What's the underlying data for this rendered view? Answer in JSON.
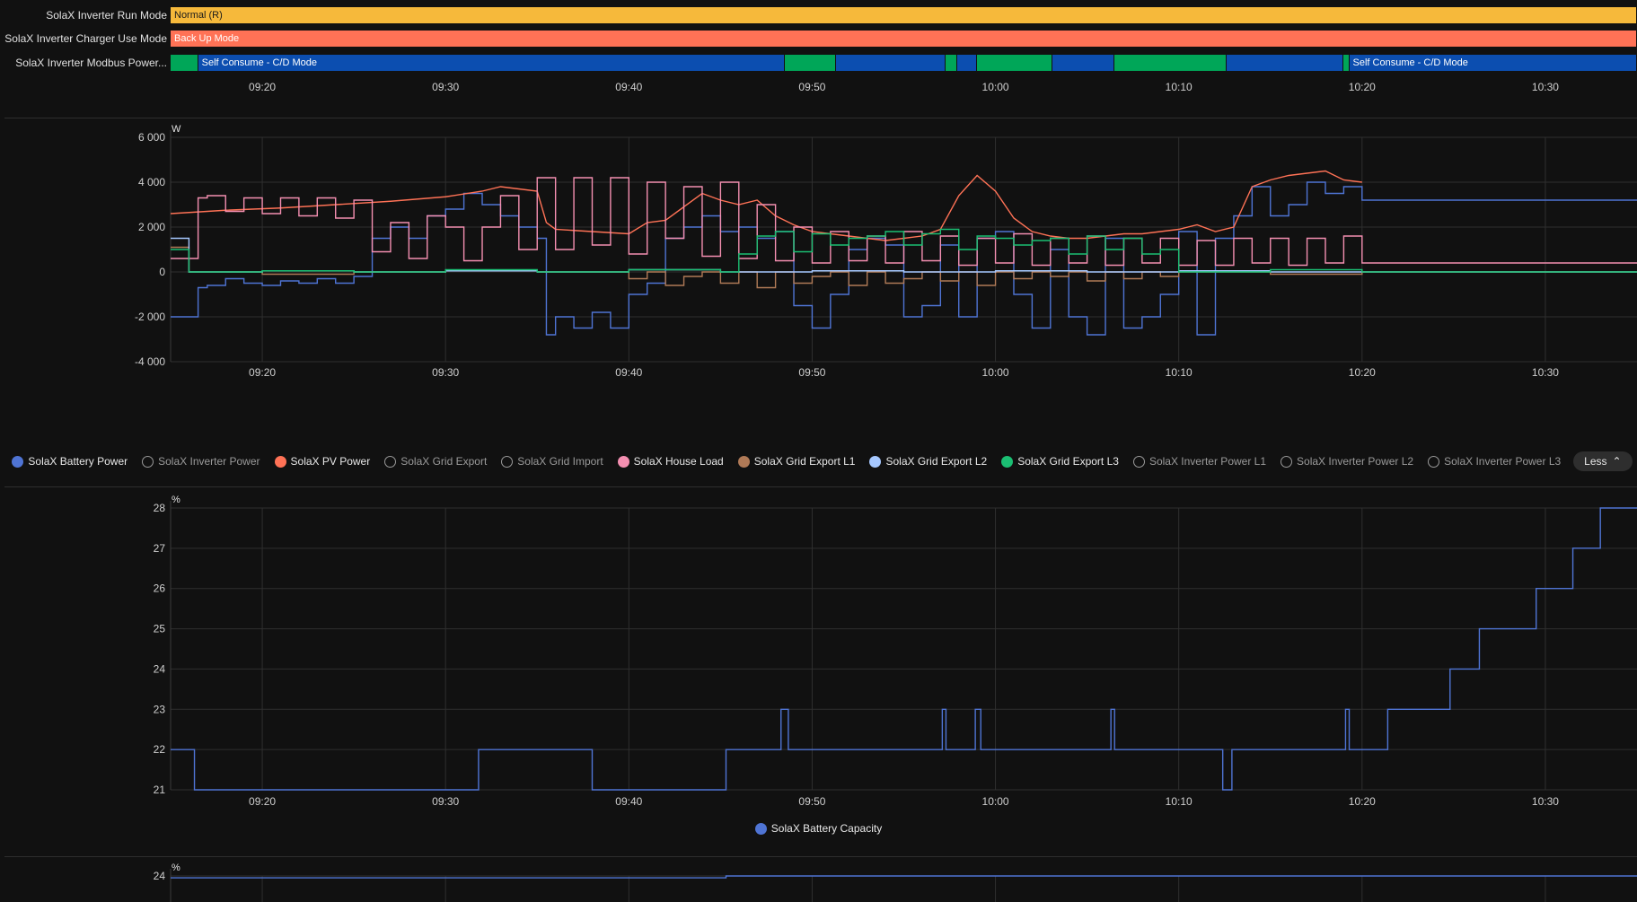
{
  "timeline": {
    "rows": [
      {
        "label": "SolaX Inverter Run Mode",
        "segments": [
          {
            "start": "09:15",
            "end": "10:35",
            "text": "Normal (R)",
            "color": "#f6b93b"
          }
        ]
      },
      {
        "label": "SolaX Inverter Charger Use Mode",
        "segments": [
          {
            "start": "09:15",
            "end": "10:35",
            "text": "Back Up Mode",
            "color": "#ff7256"
          }
        ]
      },
      {
        "label": "SolaX Inverter Modbus Power...",
        "segments": [
          {
            "start": "09:15",
            "end": "09:16.5",
            "text": "",
            "color": "#00a658"
          },
          {
            "start": "09:16.5",
            "end": "09:48.5",
            "text": "Self Consume - C/D Mode",
            "color": "#0c4eb0"
          },
          {
            "start": "09:48.5",
            "end": "09:51.3",
            "text": "",
            "color": "#00a658"
          },
          {
            "start": "09:51.3",
            "end": "09:57.3",
            "text": "",
            "color": "#0c4eb0"
          },
          {
            "start": "09:57.3",
            "end": "09:57.9",
            "text": "",
            "color": "#00a658"
          },
          {
            "start": "09:57.9",
            "end": "09:59",
            "text": "",
            "color": "#0c4eb0"
          },
          {
            "start": "09:59",
            "end": "10:03.1",
            "text": "",
            "color": "#00a658"
          },
          {
            "start": "10:03.1",
            "end": "10:06.5",
            "text": "",
            "color": "#0c4eb0"
          },
          {
            "start": "10:06.5",
            "end": "10:12.6",
            "text": "",
            "color": "#00a658"
          },
          {
            "start": "10:12.6",
            "end": "10:19",
            "text": "",
            "color": "#0c4eb0"
          },
          {
            "start": "10:19",
            "end": "10:19.3",
            "text": "",
            "color": "#00a658"
          },
          {
            "start": "10:19.3",
            "end": "10:35",
            "text": "Self Consume - C/D Mode",
            "color": "#0c4eb0"
          }
        ]
      }
    ],
    "ticks": [
      "09:20",
      "09:30",
      "09:40",
      "09:50",
      "10:00",
      "10:10",
      "10:20",
      "10:30"
    ]
  },
  "chart_data": [
    {
      "type": "line",
      "ylabel": "W",
      "ylim": [
        -4000,
        6000
      ],
      "yticks": [
        "6 000",
        "4 000",
        "2 000",
        "0",
        "-2 000",
        "-4 000"
      ],
      "yticks_values": [
        6000,
        4000,
        2000,
        0,
        -2000,
        -4000
      ],
      "xlim": [
        "09:15",
        "10:35"
      ],
      "xticks": [
        "09:20",
        "09:30",
        "09:40",
        "09:50",
        "10:00",
        "10:10",
        "10:20",
        "10:30"
      ],
      "grid": true,
      "series": [
        {
          "name": "SolaX Battery Power",
          "color": "#4f74d4",
          "visible": true,
          "step": true,
          "x": [
            15,
            16.5,
            17,
            18,
            19,
            20,
            21,
            22,
            23,
            24,
            25,
            26,
            27,
            28,
            29,
            30,
            31,
            32,
            33,
            34,
            35,
            35.5,
            36,
            37,
            38,
            39,
            40,
            41,
            42,
            43,
            44,
            45,
            46,
            47,
            48,
            49,
            50,
            51,
            52,
            53,
            54,
            55,
            56,
            57,
            58,
            59,
            60,
            61,
            62,
            63,
            64,
            65,
            66,
            67,
            68,
            69,
            70,
            71,
            72,
            73,
            74,
            75,
            76,
            77,
            78,
            79,
            80
          ],
          "y": [
            -2000,
            -700,
            -600,
            -300,
            -500,
            -600,
            -400,
            -500,
            -300,
            -500,
            -200,
            1500,
            2000,
            1500,
            2500,
            2800,
            3500,
            3000,
            2500,
            2000,
            1500,
            -2800,
            -2000,
            -2500,
            -1800,
            -2500,
            -1000,
            -500,
            1500,
            2000,
            2500,
            1800,
            2000,
            1500,
            1800,
            -1500,
            -2500,
            -1000,
            1000,
            1500,
            1200,
            -2000,
            -1500,
            1200,
            -2000,
            1500,
            1800,
            -1000,
            -2500,
            1000,
            -2000,
            -2800,
            1500,
            -2500,
            -2000,
            -1000,
            1800,
            -2800,
            1500,
            2500,
            3800,
            2500,
            3000,
            4000,
            3500,
            3800,
            3200
          ]
        },
        {
          "name": "SolaX Inverter Power",
          "color": "#888888",
          "visible": false
        },
        {
          "name": "SolaX PV Power",
          "color": "#ff7256",
          "visible": true,
          "step": false,
          "x": [
            15,
            18,
            21,
            24,
            27,
            30,
            32,
            33,
            34,
            35,
            35.5,
            36,
            37,
            38,
            39,
            40,
            41,
            42,
            43,
            44,
            45,
            46,
            47,
            48,
            49,
            50,
            51,
            52,
            53,
            54,
            55,
            56,
            57,
            58,
            59,
            60,
            61,
            62,
            63,
            64,
            65,
            66,
            67,
            68,
            69,
            70,
            71,
            72,
            73,
            74,
            75,
            76,
            77,
            78,
            79,
            80
          ],
          "y": [
            2600,
            2750,
            2850,
            3000,
            3150,
            3350,
            3600,
            3800,
            3700,
            3600,
            2200,
            1900,
            1850,
            1800,
            1750,
            1700,
            2200,
            2300,
            2900,
            3500,
            3200,
            3000,
            3200,
            2500,
            2100,
            1800,
            1700,
            1600,
            1500,
            1400,
            1500,
            1600,
            1900,
            3400,
            4300,
            3600,
            2400,
            1800,
            1600,
            1500,
            1500,
            1600,
            1700,
            1700,
            1800,
            1900,
            2100,
            1800,
            2000,
            3800,
            4100,
            4300,
            4400,
            4500,
            4100,
            4000
          ]
        },
        {
          "name": "SolaX Grid Export",
          "color": "#888888",
          "visible": false
        },
        {
          "name": "SolaX Grid Import",
          "color": "#888888",
          "visible": false
        },
        {
          "name": "SolaX House Load",
          "color": "#f48fb1",
          "visible": true,
          "step": true,
          "x": [
            15,
            16.5,
            17,
            18,
            19,
            20,
            21,
            22,
            23,
            24,
            25,
            26,
            27,
            28,
            29,
            30,
            31,
            32,
            33,
            34,
            35,
            36,
            37,
            38,
            39,
            40,
            41,
            42,
            43,
            44,
            45,
            46,
            47,
            48,
            49,
            50,
            51,
            52,
            53,
            54,
            55,
            56,
            57,
            58,
            59,
            60,
            61,
            62,
            63,
            64,
            65,
            66,
            67,
            68,
            69,
            70,
            71,
            72,
            73,
            74,
            75,
            76,
            77,
            78,
            79,
            80
          ],
          "y": [
            600,
            3300,
            3400,
            2700,
            3300,
            2600,
            3300,
            2500,
            3300,
            2400,
            3200,
            900,
            2200,
            600,
            2500,
            2000,
            500,
            2000,
            3400,
            1000,
            4200,
            1000,
            4200,
            1200,
            4200,
            800,
            4000,
            1500,
            3800,
            700,
            4000,
            600,
            3000,
            500,
            2000,
            400,
            1800,
            500,
            1600,
            400,
            1800,
            500,
            1600,
            300,
            1500,
            400,
            1700,
            300,
            1500,
            400,
            1600,
            300,
            1500,
            400,
            1500,
            300,
            1400,
            300,
            1500,
            400,
            1500,
            300,
            1500,
            400,
            1600,
            400
          ]
        },
        {
          "name": "SolaX Grid Export L1",
          "color": "#b07a57",
          "visible": true,
          "step": true,
          "x": [
            15,
            16,
            20,
            25,
            30,
            35,
            40,
            41,
            42,
            43,
            44,
            45,
            46,
            47,
            48,
            49,
            50,
            51,
            52,
            53,
            54,
            55,
            56,
            57,
            58,
            59,
            60,
            61,
            62,
            63,
            64,
            65,
            66,
            67,
            68,
            69,
            70,
            75,
            80
          ],
          "y": [
            1100,
            0,
            -100,
            0,
            50,
            0,
            -300,
            0,
            -600,
            -200,
            0,
            -500,
            0,
            -700,
            0,
            -500,
            -200,
            0,
            -600,
            0,
            -500,
            -300,
            0,
            -400,
            0,
            -600,
            0,
            -300,
            0,
            -200,
            0,
            -400,
            0,
            -300,
            0,
            -200,
            0,
            -100,
            0
          ]
        },
        {
          "name": "SolaX Grid Export L2",
          "color": "#a6c8ff",
          "visible": true,
          "step": true,
          "x": [
            15,
            16,
            20,
            25,
            30,
            35,
            40,
            45,
            50,
            55,
            60,
            65,
            70,
            75,
            80
          ],
          "y": [
            1500,
            0,
            50,
            0,
            50,
            0,
            100,
            0,
            50,
            0,
            50,
            0,
            50,
            0,
            0
          ]
        },
        {
          "name": "SolaX Grid Export L3",
          "color": "#1bbf73",
          "visible": true,
          "step": true,
          "x": [
            15,
            16,
            20,
            25,
            30,
            35,
            40,
            45,
            46,
            47,
            48,
            49,
            50,
            51,
            52,
            53,
            54,
            55,
            56,
            57,
            58,
            59,
            60,
            61,
            62,
            63,
            64,
            65,
            66,
            67,
            68,
            69,
            70,
            75,
            80
          ],
          "y": [
            1000,
            0,
            50,
            0,
            100,
            0,
            100,
            0,
            800,
            1600,
            1800,
            900,
            1700,
            1200,
            1500,
            1600,
            1800,
            1200,
            1700,
            1900,
            1000,
            1600,
            1500,
            1200,
            1400,
            1500,
            800,
            1600,
            1000,
            1500,
            800,
            1000,
            0,
            100,
            0
          ]
        },
        {
          "name": "SolaX Inverter Power L1",
          "color": "#888888",
          "visible": false
        },
        {
          "name": "SolaX Inverter Power L2",
          "color": "#888888",
          "visible": false
        },
        {
          "name": "SolaX Inverter Power L3",
          "color": "#888888",
          "visible": false
        }
      ]
    },
    {
      "type": "line",
      "ylabel": "%",
      "ylim": [
        21,
        28
      ],
      "yticks": [
        "28",
        "27",
        "26",
        "25",
        "24",
        "23",
        "22",
        "21"
      ],
      "yticks_values": [
        28,
        27,
        26,
        25,
        24,
        23,
        22,
        21
      ],
      "xlim": [
        "09:15",
        "10:35"
      ],
      "xticks": [
        "09:20",
        "09:30",
        "09:40",
        "09:50",
        "10:00",
        "10:10",
        "10:20",
        "10:30"
      ],
      "grid": true,
      "series": [
        {
          "name": "SolaX Battery Capacity",
          "color": "#4f74d4",
          "visible": true,
          "step": true,
          "x": [
            15,
            16.3,
            31.8,
            38,
            45.3,
            48.3,
            48.7,
            57.1,
            57.3,
            58.9,
            59.2,
            66.3,
            66.5,
            72.4,
            72.9,
            79.1,
            79.3,
            81.4,
            84.8,
            86.4,
            89.5,
            91.5,
            93,
            94.5,
            95
          ],
          "y": [
            22,
            21,
            22,
            21,
            22,
            23,
            22,
            23,
            22,
            23,
            22,
            23,
            22,
            21,
            22,
            23,
            22,
            23,
            24,
            25,
            26,
            27,
            28,
            28,
            28
          ]
        }
      ]
    },
    {
      "type": "line",
      "ylabel": "%",
      "ylim": [
        21,
        24
      ],
      "yticks": [
        "24"
      ],
      "yticks_values": [
        24
      ],
      "xlim": [
        "09:15",
        "10:35"
      ],
      "grid": true,
      "series": [
        {
          "name": "",
          "color": "#4f74d4",
          "visible": true,
          "step": true,
          "x": [
            15,
            45.3,
            95
          ],
          "y": [
            23.9,
            24,
            24
          ]
        }
      ]
    }
  ],
  "legend": {
    "less_label": "Less"
  },
  "legend2": {
    "items": [
      {
        "name": "SolaX Battery Capacity",
        "color": "#4f74d4",
        "visible": true
      }
    ]
  }
}
